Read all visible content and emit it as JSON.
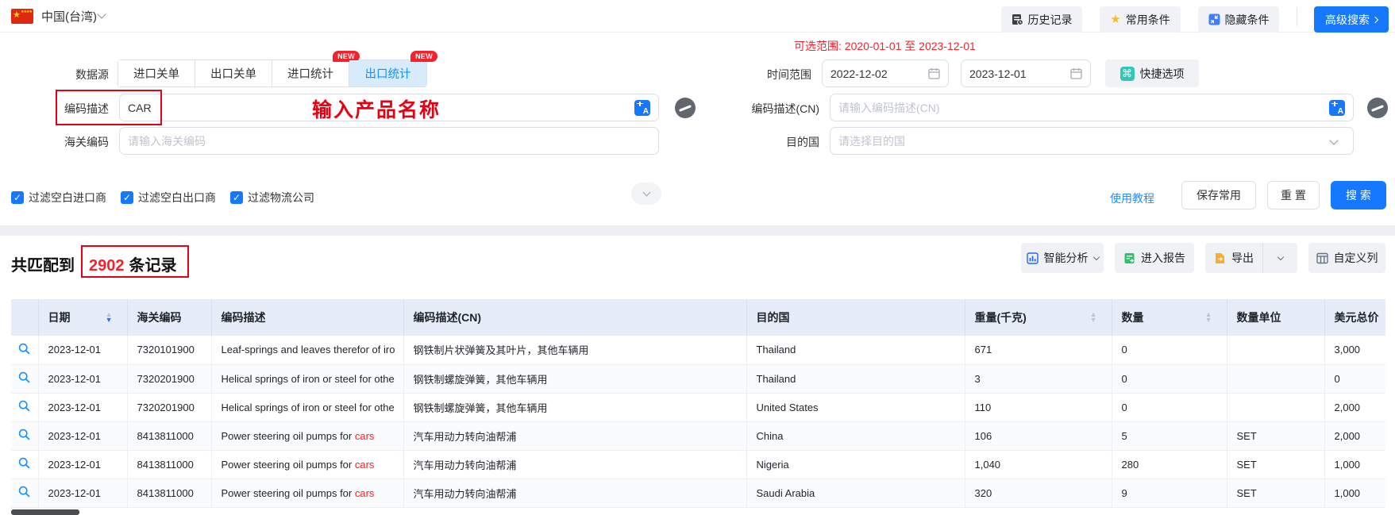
{
  "icons": {
    "star": "★",
    "command": "⌘",
    "small_stars": "★★★★",
    "check": "✓"
  },
  "header": {
    "country": "中国(台湾)",
    "history_label": "历史记录",
    "favorites_label": "常用条件",
    "hide_label": "隐藏条件",
    "advanced_label": "高级搜索"
  },
  "filters": {
    "data_source": {
      "label": "数据源",
      "tabs": [
        {
          "label": "进口关单",
          "badge": ""
        },
        {
          "label": "出口关单",
          "badge": ""
        },
        {
          "label": "进口统计",
          "badge": "NEW"
        },
        {
          "label": "出口统计",
          "badge": "NEW"
        }
      ],
      "active_tab": "出口统计"
    },
    "date_range": {
      "label": "时间范围",
      "hint": "可选范围: 2020-01-01 至 2023-12-01",
      "start": "2022-12-02",
      "end": "2023-12-01",
      "quick_label": "快捷选项"
    },
    "code_desc": {
      "label": "编码描述",
      "value": "CAR",
      "annotation": "输入产品名称"
    },
    "code_desc_cn": {
      "label": "编码描述(CN)",
      "placeholder": "请输入编码描述(CN)"
    },
    "hs_code": {
      "label": "海关编码",
      "placeholder": "请输入海关编码"
    },
    "dest_country": {
      "label": "目的国",
      "placeholder": "请选择目的国"
    },
    "checkboxes": [
      {
        "label": "过滤空白进口商",
        "checked": true
      },
      {
        "label": "过滤空白出口商",
        "checked": true
      },
      {
        "label": "过滤物流公司",
        "checked": true
      }
    ],
    "actions": {
      "tutorial": "使用教程",
      "save": "保存常用",
      "reset": "重 置",
      "search": "搜 索"
    }
  },
  "results": {
    "prefix": "共匹配到",
    "count": "2902",
    "suffix": "条记录",
    "toolbar": {
      "analysis": "智能分析",
      "report": "进入报告",
      "export": "导出",
      "columns": "自定义列"
    }
  },
  "table": {
    "columns": [
      {
        "label": ""
      },
      {
        "label": "日期",
        "sortable": true,
        "active_sort": "desc"
      },
      {
        "label": "海关编码"
      },
      {
        "label": "编码描述"
      },
      {
        "label": "编码描述(CN)"
      },
      {
        "label": "目的国"
      },
      {
        "label": "重量(千克)",
        "sortable": true
      },
      {
        "label": "数量",
        "sortable": true
      },
      {
        "label": "数量单位"
      },
      {
        "label": "美元总价"
      }
    ],
    "rows": [
      {
        "date": "2023-12-01",
        "hs_code": "7320101900",
        "desc": "Leaf-springs and leaves therefor of iro",
        "desc_highlight": "",
        "desc_cn": "钢铁制片状弹簧及其叶片，其他车辆用",
        "dest": "Thailand",
        "weight": "671",
        "qty": "0",
        "unit": "",
        "total": "3,000"
      },
      {
        "date": "2023-12-01",
        "hs_code": "7320201900",
        "desc": "Helical springs of iron or steel for othe",
        "desc_highlight": "",
        "desc_cn": "钢铁制螺旋弹簧，其他车辆用",
        "dest": "Thailand",
        "weight": "3",
        "qty": "0",
        "unit": "",
        "total": "0"
      },
      {
        "date": "2023-12-01",
        "hs_code": "7320201900",
        "desc": "Helical springs of iron or steel for othe",
        "desc_highlight": "",
        "desc_cn": "钢铁制螺旋弹簧，其他车辆用",
        "dest": "United States",
        "weight": "110",
        "qty": "0",
        "unit": "",
        "total": "2,000"
      },
      {
        "date": "2023-12-01",
        "hs_code": "8413811000",
        "desc": "Power steering oil pumps for ",
        "desc_highlight": "cars",
        "desc_cn": "汽车用动力转向油帮浦",
        "dest": "China",
        "weight": "106",
        "qty": "5",
        "unit": "SET",
        "total": "2,000"
      },
      {
        "date": "2023-12-01",
        "hs_code": "8413811000",
        "desc": "Power steering oil pumps for ",
        "desc_highlight": "cars",
        "desc_cn": "汽车用动力转向油帮浦",
        "dest": "Nigeria",
        "weight": "1,040",
        "qty": "280",
        "unit": "SET",
        "total": "1,000"
      },
      {
        "date": "2023-12-01",
        "hs_code": "8413811000",
        "desc": "Power steering oil pumps for ",
        "desc_highlight": "cars",
        "desc_cn": "汽车用动力转向油帮浦",
        "dest": "Saudi Arabia",
        "weight": "320",
        "qty": "9",
        "unit": "SET",
        "total": "1,000"
      }
    ]
  }
}
